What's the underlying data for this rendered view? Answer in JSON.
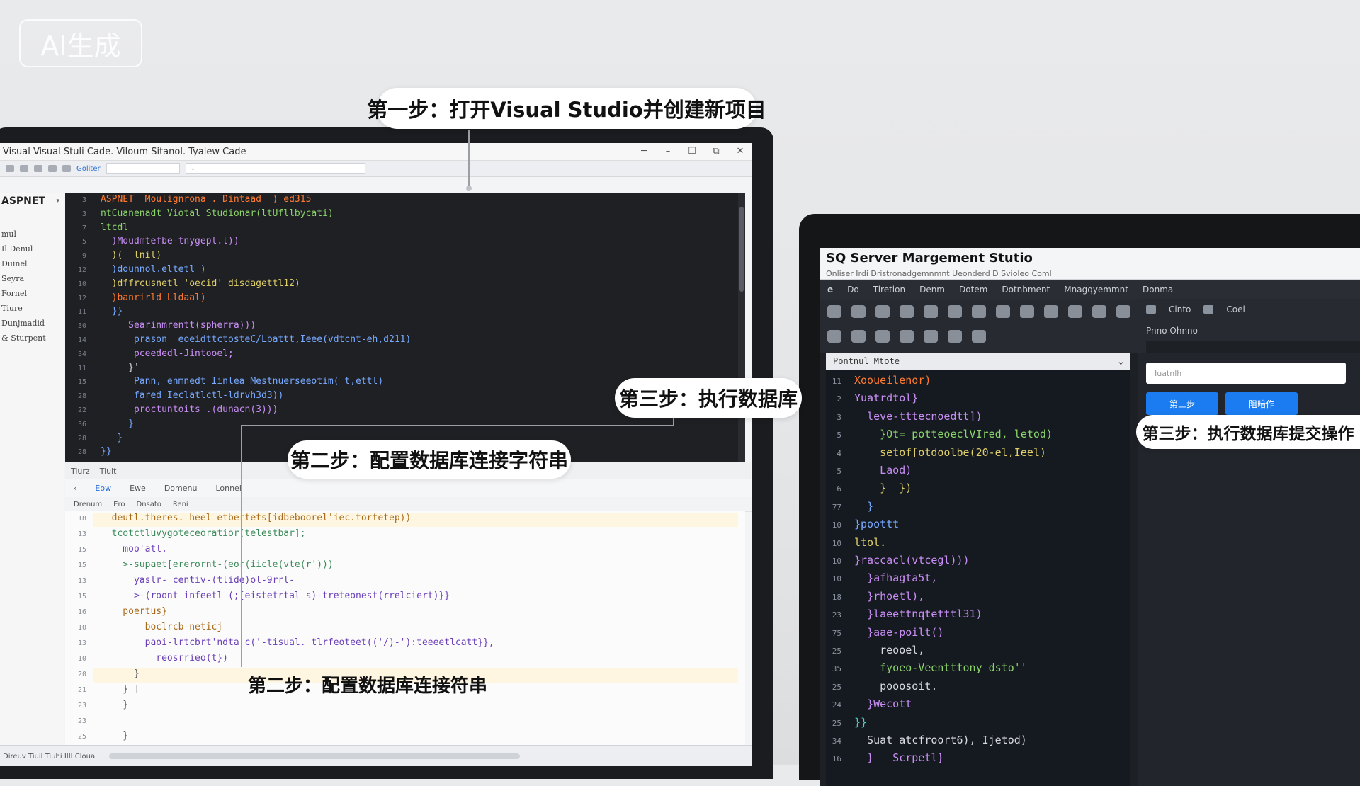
{
  "badge": "AI生成",
  "annotations": {
    "step1": "第一步：打开Visual Studio并创建新项目",
    "step2a": "第二步：配置数据库连接字符串",
    "step2b": "第二步：配置数据库连接符串",
    "step3a": "第三步：执行数据库",
    "step3b": "第三步：执行数据库提交操作"
  },
  "left_window": {
    "title": "Visual Visual Stuli Cade. Viloum Sitanol. Tyalew Cade",
    "sidebar_head": "ASPNET",
    "sidebar_items": [
      "mul",
      "Il Denul",
      "Duinel",
      "Seyra",
      "Fornel",
      "Tiure",
      "Dunjmadid",
      "& Sturpent"
    ],
    "toolbar_tab": "Goliter",
    "panel_bar_labels": [
      "Tiurz",
      "Tiuit"
    ],
    "panel_tabs": [
      "Eow",
      "Ewe",
      "Domenu",
      "Lonnel"
    ],
    "panel_sub": [
      "Drenum",
      "Ero",
      "Dnsato",
      "Reni"
    ],
    "status": "Direuv Tiuil Tiuhi IIII Cloua"
  },
  "right_window": {
    "title": "SQ Server Margement Stutio",
    "subtitle": "Onliser Irdi Dristronadgemnmnt Ueonderd D Svioleo Coml",
    "menu": [
      "Do",
      "Tiretion",
      "Denm",
      "Dotem",
      "Dotnbment",
      "Mnagqyemmnt",
      "Donma"
    ],
    "tool_right": [
      "Cinto",
      "Coel"
    ],
    "panel_label": "Pnno Ohnno",
    "code_head": "Pontnul Mtote",
    "input_placeholder": "Iuatnlh",
    "btn1": "第三步",
    "btn2": "阻暗作"
  },
  "code_top": [
    {
      "n": "3",
      "t": "ASPNET  Moulignrona . Dintaad  ) ed315",
      "c": "c-or"
    },
    {
      "n": "3",
      "t": "ntCuanenadt Viotal Studionar(ltUfllbycati)",
      "c": "c-gr"
    },
    {
      "n": "7",
      "t": "ltcdl",
      "c": "c-gr"
    },
    {
      "n": "5",
      "t": "  )Moudmtefbe-tnygepl.l))",
      "c": "c-pu"
    },
    {
      "n": "9",
      "t": "  )(  lnil)",
      "c": "c-ye"
    },
    {
      "n": "12",
      "t": "  )dounnol.eltetl )",
      "c": "c-bl"
    },
    {
      "n": "10",
      "t": "  )dffrcusnetl 'oecid' disdagettl12)",
      "c": "c-ye"
    },
    {
      "n": "12",
      "t": "  )banrirld Lldaal)",
      "c": "c-or"
    },
    {
      "n": "11",
      "t": "  }}",
      "c": "c-bl"
    },
    {
      "n": "30",
      "t": "     Searinmrentt(spherra)))",
      "c": "c-pu"
    },
    {
      "n": "14",
      "t": "      prason  eoeidttctosteC/Lbattt,Ieee(vdtcnt-eh,d211)",
      "c": "c-bl"
    },
    {
      "n": "34",
      "t": "      pceededl-Jintooel;",
      "c": "c-pu"
    },
    {
      "n": "11",
      "t": "     }'",
      "c": "c-wh"
    },
    {
      "n": "15",
      "t": "      Pann, enmnedt Iinlea Mestnuerseeotim( t,ettl)",
      "c": "c-bl"
    },
    {
      "n": "28",
      "t": "      fared Ieclatlctl-ldrvh3d3))",
      "c": "c-bl"
    },
    {
      "n": "22",
      "t": "      proctuntoits .(dunacn(3)))",
      "c": "c-pu"
    },
    {
      "n": "36",
      "t": "     }",
      "c": "c-bl"
    },
    {
      "n": "28",
      "t": "   }",
      "c": "c-bl"
    },
    {
      "n": "28",
      "t": "}}",
      "c": "c-bl"
    }
  ],
  "code_bottom": [
    {
      "n": "18",
      "t": "  deutl.theres. heel etbertets[idbeboorel'iec.tortetep))",
      "c": "c-br"
    },
    {
      "n": "13",
      "t": "  tcotctluvygoteceoratior(telestbar];",
      "c": "c-dg"
    },
    {
      "n": "15",
      "t": "    moo'atl.",
      "c": "c-dp"
    },
    {
      "n": "15",
      "t": "    >-supaet[ererornt-(eor(iicle(vte(r')))",
      "c": "c-dg"
    },
    {
      "n": "13",
      "t": "      yaslr- centiv-(tlide)ol-9rrl-",
      "c": "c-dp"
    },
    {
      "n": "15",
      "t": "      >-(roont infeetl (;[eistetrtal s)-treteonest(rrelciert)}}",
      "c": "c-dp"
    },
    {
      "n": "16",
      "t": "    poertus}",
      "c": "c-br"
    },
    {
      "n": "10",
      "t": "        boclrcb-neticj",
      "c": "c-br"
    },
    {
      "n": "13",
      "t": "        paoi-lrtcbrt'ndta c('-tisual. tlrfeoteet(('/)-'):teeeetlcatt}},",
      "c": "c-dp"
    },
    {
      "n": "10",
      "t": "          reosrrieo(t})",
      "c": "c-dp"
    },
    {
      "n": "20",
      "t": "      }",
      "c": "c-gy"
    },
    {
      "n": "21",
      "t": "    } ]",
      "c": "c-gy"
    },
    {
      "n": "23",
      "t": "    }",
      "c": "c-gy"
    },
    {
      "n": "23",
      "t": "",
      "c": "c-gy"
    },
    {
      "n": "25",
      "t": "    }",
      "c": "c-gy"
    }
  ],
  "code_right": [
    {
      "n": "11",
      "t": "Xooueilenor)",
      "c": "c-or"
    },
    {
      "n": "2",
      "t": "Yuatrdtol}",
      "c": "c-pu"
    },
    {
      "n": "3",
      "t": "  leve-tttecnoedtt])",
      "c": "c-pu"
    },
    {
      "n": "5",
      "t": "    }Ot= potteoeclVIred, letod)",
      "c": "c-gr"
    },
    {
      "n": "4",
      "t": "    setof[otdoolbe(20-el,Ieel)",
      "c": "c-ye"
    },
    {
      "n": "5",
      "t": "    Laod)",
      "c": "c-pu"
    },
    {
      "n": "6",
      "t": "    }  })",
      "c": "c-ye"
    },
    {
      "n": "77",
      "t": "  }",
      "c": "c-bl"
    },
    {
      "n": "10",
      "t": "}poottt",
      "c": "c-bl"
    },
    {
      "n": "10",
      "t": "ltol.",
      "c": "c-ye"
    },
    {
      "n": "10",
      "t": "}raccacl(vtcegl)))",
      "c": "c-pu"
    },
    {
      "n": "10",
      "t": "  }afhagta5t,",
      "c": "c-pu"
    },
    {
      "n": "18",
      "t": "  }rhoetl),",
      "c": "c-pu"
    },
    {
      "n": "23",
      "t": "  }laeettnqtetttl31)",
      "c": "c-pu"
    },
    {
      "n": "75",
      "t": "  }aae-poilt()",
      "c": "c-pu"
    },
    {
      "n": "25",
      "t": "    reooel,",
      "c": "c-wh"
    },
    {
      "n": "35",
      "t": "    fyoeo-Veentttony dsto''",
      "c": "c-gr"
    },
    {
      "n": "25",
      "t": "    pooosoit.",
      "c": "c-wh"
    },
    {
      "n": "24",
      "t": "  }Wecott",
      "c": "c-pu"
    },
    {
      "n": "25",
      "t": "}}",
      "c": "c-cy"
    },
    {
      "n": "34",
      "t": "  Suat atcfroort6), Ijetod)",
      "c": "c-wh"
    },
    {
      "n": "16",
      "t": "  }   Scrpetl}",
      "c": "c-pu"
    }
  ]
}
